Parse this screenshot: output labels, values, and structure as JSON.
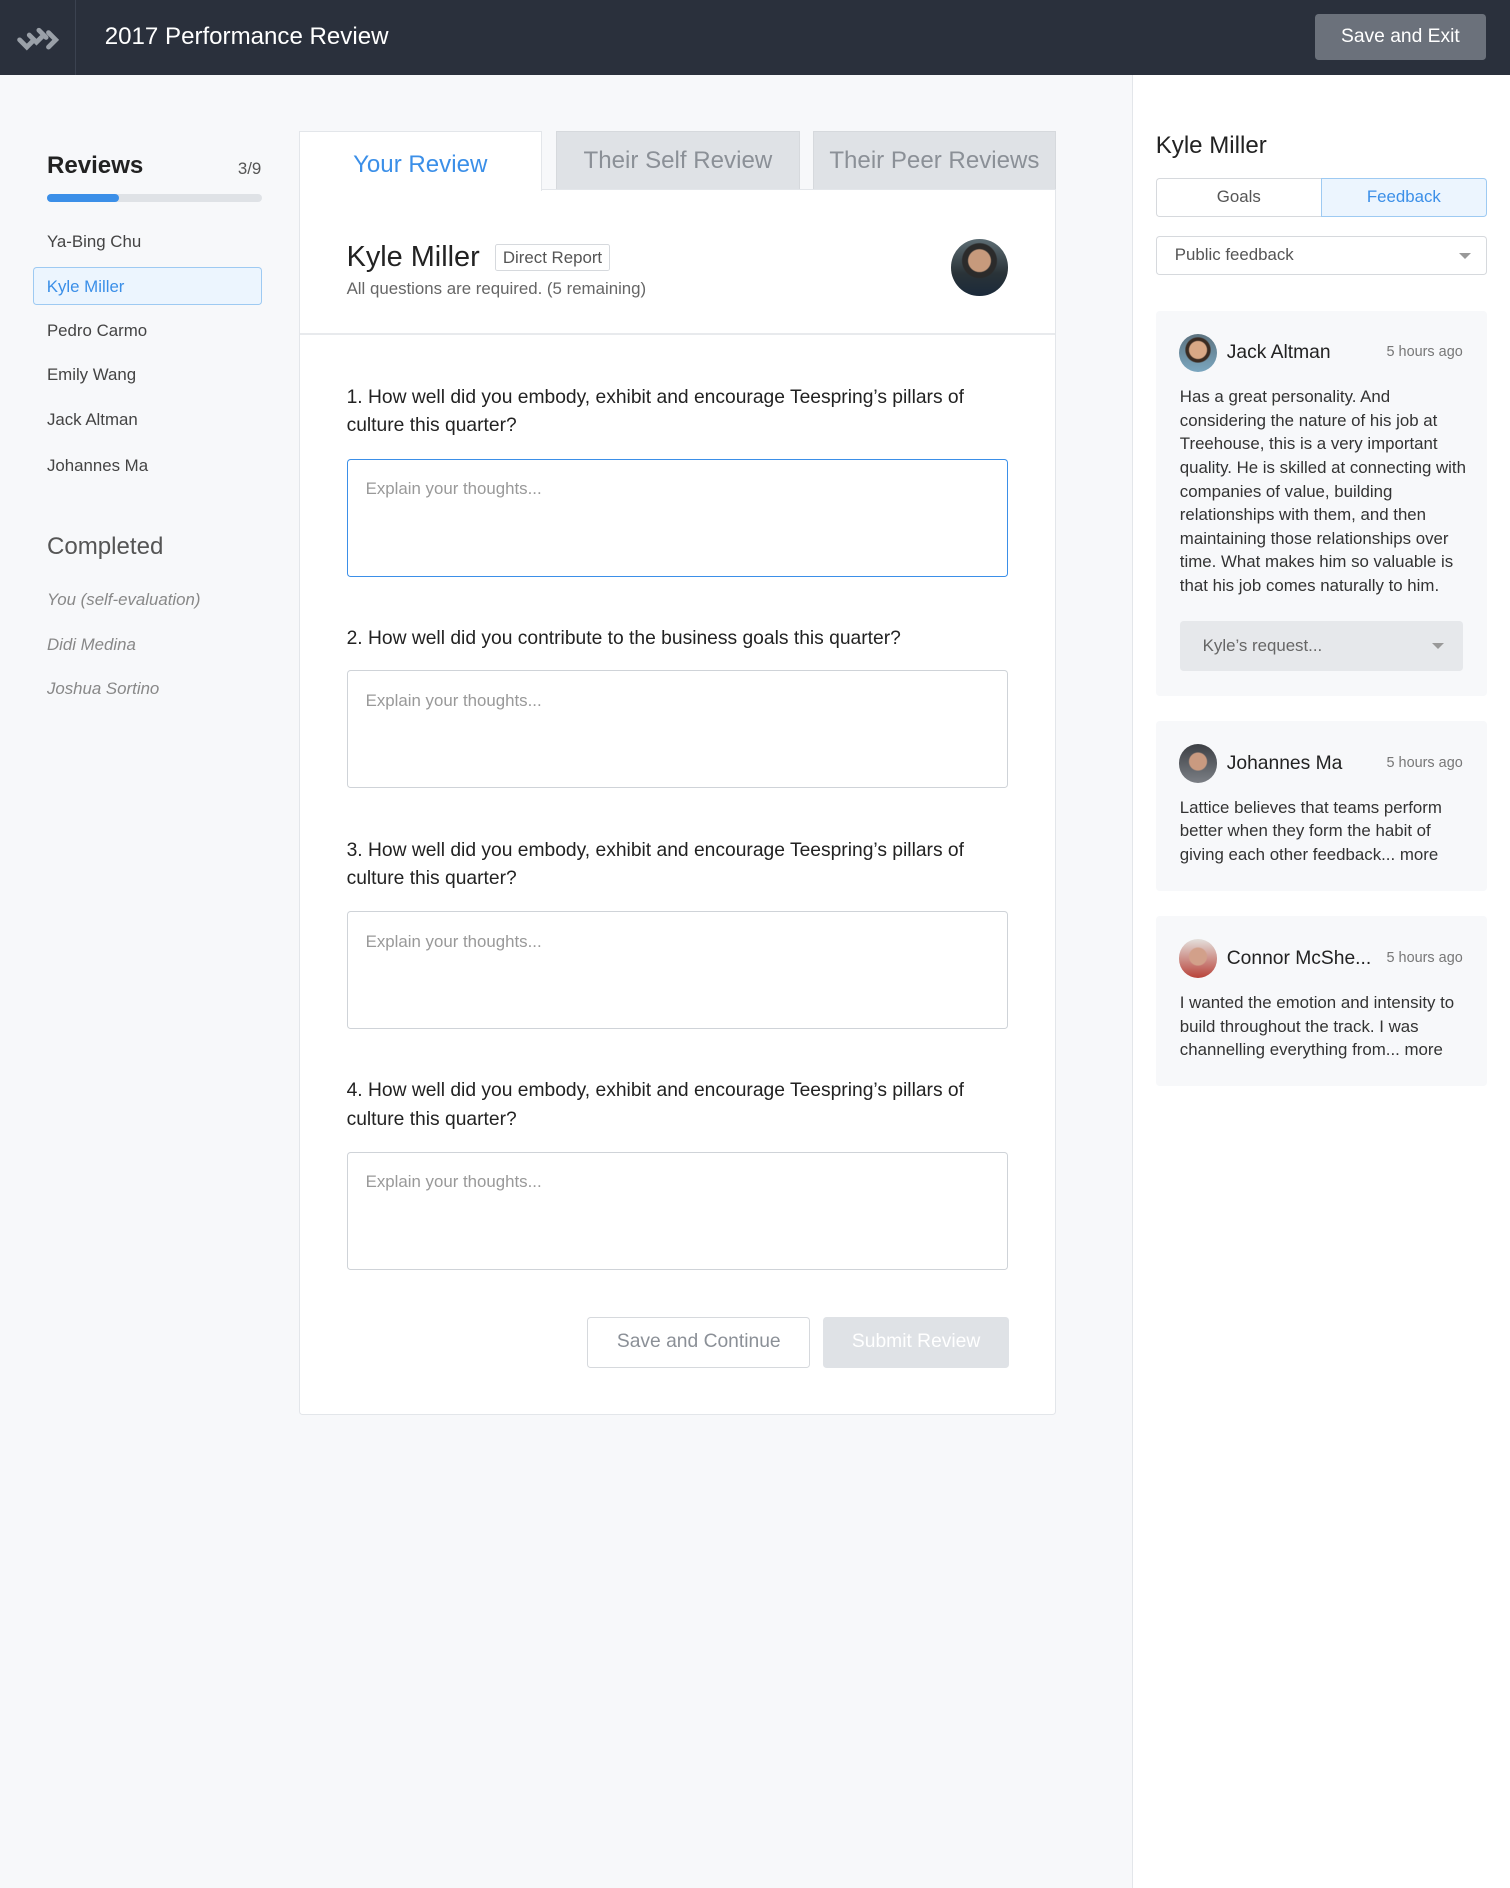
{
  "header": {
    "title": "2017 Performance Review",
    "save_exit": "Save and Exit",
    "logo": "lattice-logo"
  },
  "sidebar": {
    "reviews_heading": "Reviews",
    "reviews_count": "3/9",
    "progress_fraction": 0.333,
    "items": [
      {
        "label": "Ya-Bing Chu"
      },
      {
        "label": "Kyle Miller",
        "selected": true
      },
      {
        "label": "Pedro Carmo"
      },
      {
        "label": "Emily Wang"
      },
      {
        "label": "Jack Altman"
      },
      {
        "label": "Johannes Ma"
      }
    ],
    "completed_heading": "Completed",
    "completed": [
      {
        "label": "You (self-evaluation)"
      },
      {
        "label": "Didi Medina"
      },
      {
        "label": "Joshua Sortino"
      }
    ]
  },
  "tabs": [
    {
      "label": "Your Review",
      "active": true
    },
    {
      "label": "Their Self Review"
    },
    {
      "label": "Their Peer Reviews"
    }
  ],
  "review": {
    "name": "Kyle Miller",
    "badge": "Direct Report",
    "required_note": "All questions are required. (5 remaining)",
    "placeholder": "Explain your thoughts...",
    "questions": [
      {
        "text": "1. How well did you embody, exhibit and encourage Teespring’s pillars of culture this quarter?"
      },
      {
        "text": "2. How well did you contribute to the business goals this quarter?"
      },
      {
        "text": "3. How well did you embody, exhibit and encourage Teespring’s pillars of culture this quarter?"
      },
      {
        "text": "4. How well did you embody, exhibit and encourage Teespring’s pillars of culture this quarter?"
      }
    ],
    "save_continue": "Save and Continue",
    "submit": "Submit Review"
  },
  "panel": {
    "name": "Kyle Miller",
    "segments": [
      "Goals",
      "Feedback"
    ],
    "active_segment": "Feedback",
    "filter": "Public feedback",
    "feedback": [
      {
        "author": "Jack Altman",
        "time": "5 hours ago",
        "text": "Has a great personality. And considering the nature of his job at Treehouse, this is a very important quality. He is skilled at connecting with companies of value, building relationships with them, and then maintaining those relationships over time. What makes him so valuable is that his job comes naturally to him.",
        "request": "Kyle’s request..."
      },
      {
        "author": "Johannes Ma",
        "time": "5 hours ago",
        "text": "Lattice believes that teams perform better when they form the habit of giving each other feedback... more"
      },
      {
        "author": "Connor McShe...",
        "time": "5 hours ago",
        "text": "I wanted the emotion and intensity to build throughout the track. I was channelling everything from... more"
      }
    ]
  },
  "colors": {
    "accent": "#3b8fe8",
    "header": "#2a303c"
  }
}
